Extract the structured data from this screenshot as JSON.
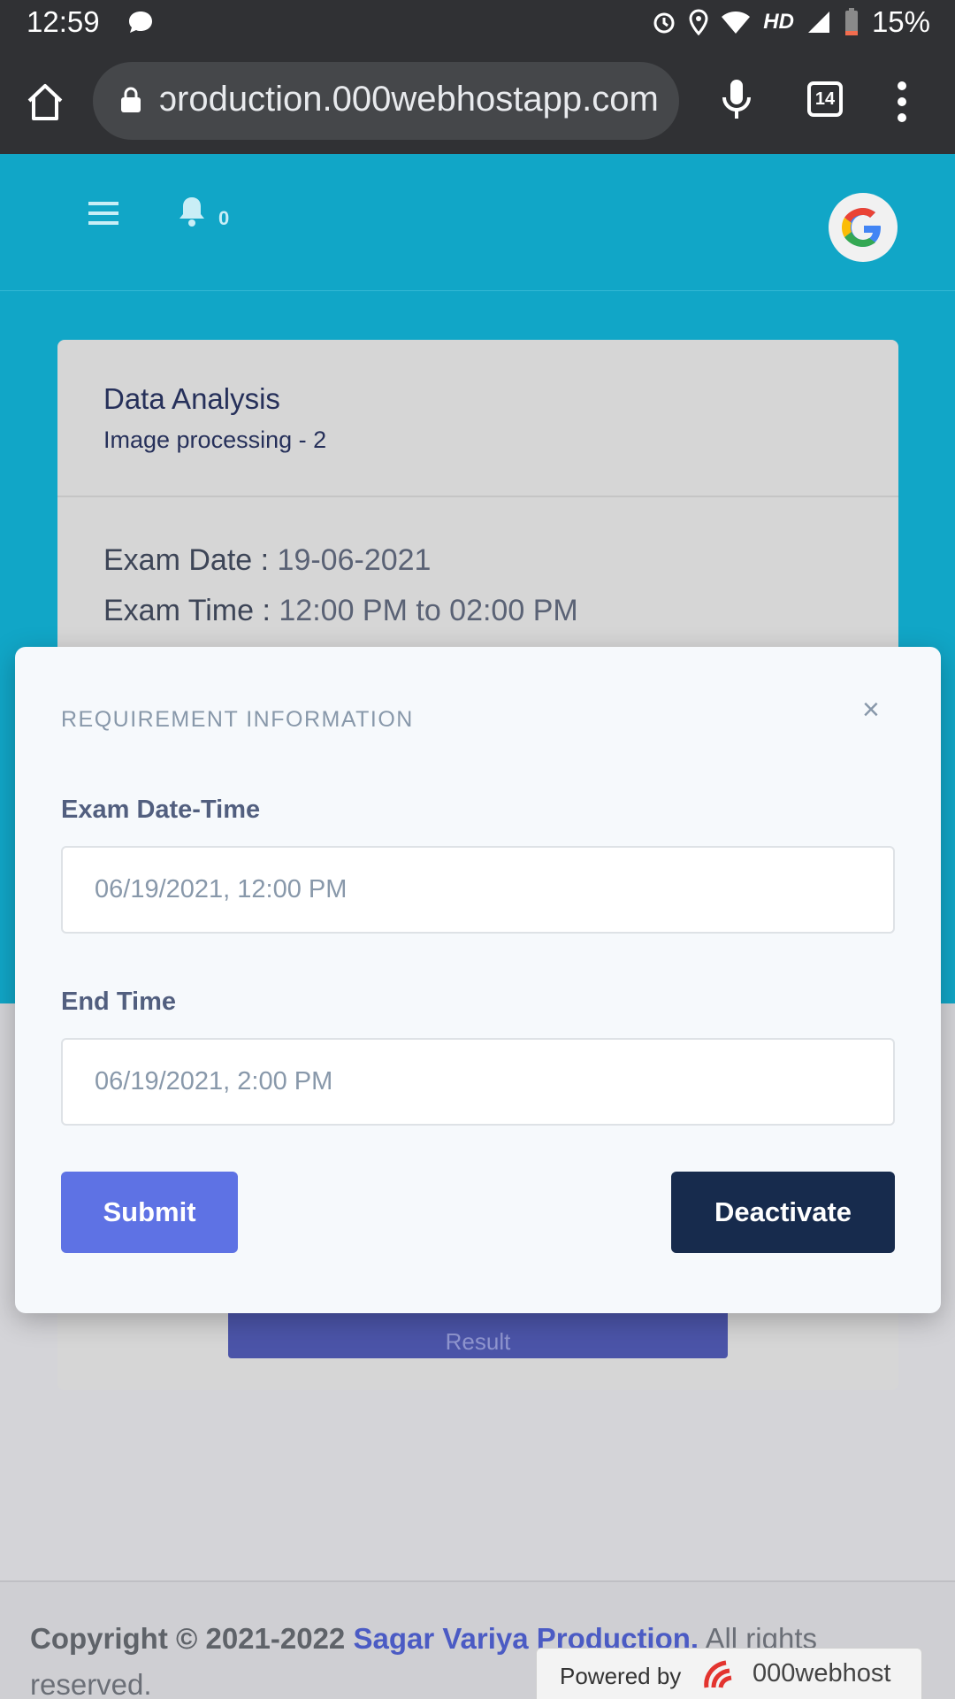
{
  "status_bar": {
    "time": "12:59",
    "network": "HD",
    "battery": "15%"
  },
  "browser": {
    "url": "production.000webhostapp.com",
    "url_display": "ɔroduction.000webhostapp.com",
    "tab_count": "14"
  },
  "app_bar": {
    "notification_count": "0"
  },
  "card": {
    "title": "Data Analysis",
    "subtitle": "Image processing - 2",
    "exam_date_label": "Exam Date :",
    "exam_date": "19-06-2021",
    "exam_time_label": "Exam Time :",
    "exam_time": "12:00 PM to 02:00 PM",
    "result_button": "Result"
  },
  "modal": {
    "title": "REQUIREMENT INFORMATION",
    "close": "×",
    "exam_datetime_label": "Exam Date-Time",
    "exam_datetime_value": "06/19/2021, 12:00 PM",
    "end_time_label": "End Time",
    "end_time_value": "06/19/2021, 2:00 PM",
    "submit_label": "Submit",
    "deactivate_label": "Deactivate"
  },
  "footer": {
    "copyright_prefix": "Copyright © 2021-2022",
    "brand": "Sagar Variya Production.",
    "suffix": "All rights reserved.",
    "powered_by": "Powered by",
    "host": "000webhost"
  },
  "colors": {
    "accent": "#11a6c7",
    "primary_button": "#5e72e4",
    "dark_button": "#172b4d",
    "brand_link": "#4b5bc4"
  }
}
